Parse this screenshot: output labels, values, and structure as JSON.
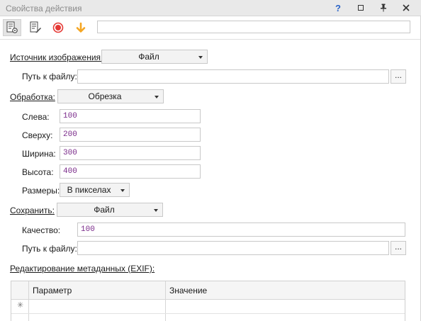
{
  "window": {
    "title": "Свойства действия",
    "help_label": "?"
  },
  "toolbar": {
    "buttons": [
      {
        "icon": "properties-settings-icon"
      },
      {
        "icon": "edit-notes-icon"
      },
      {
        "icon": "record-icon",
        "color": "#e53935"
      },
      {
        "icon": "arrow-down-icon",
        "color": "#f5a623"
      }
    ],
    "search_value": ""
  },
  "source": {
    "label": "Источник изображения:",
    "value": "Файл",
    "path_label": "Путь к файлу:",
    "path_value": "",
    "browse_label": "..."
  },
  "processing": {
    "label": "Обработка:",
    "value": "Обрезка",
    "fields": [
      {
        "label": "Слева:",
        "value": "100"
      },
      {
        "label": "Сверху:",
        "value": "200"
      },
      {
        "label": "Ширина:",
        "value": "300"
      },
      {
        "label": "Высота:",
        "value": "400"
      }
    ],
    "size_label": "Размеры:",
    "size_value": "В пикселах"
  },
  "save": {
    "label": "Сохранить:",
    "value": "Файл",
    "quality_label": "Качество:",
    "quality_value": "100",
    "path_label": "Путь к файлу:",
    "path_value": "",
    "browse_label": "..."
  },
  "metadata": {
    "label": "Редактирование метаданных (EXIF):",
    "columns": [
      "Параметр",
      "Значение"
    ],
    "new_row_marker": "✳"
  }
}
